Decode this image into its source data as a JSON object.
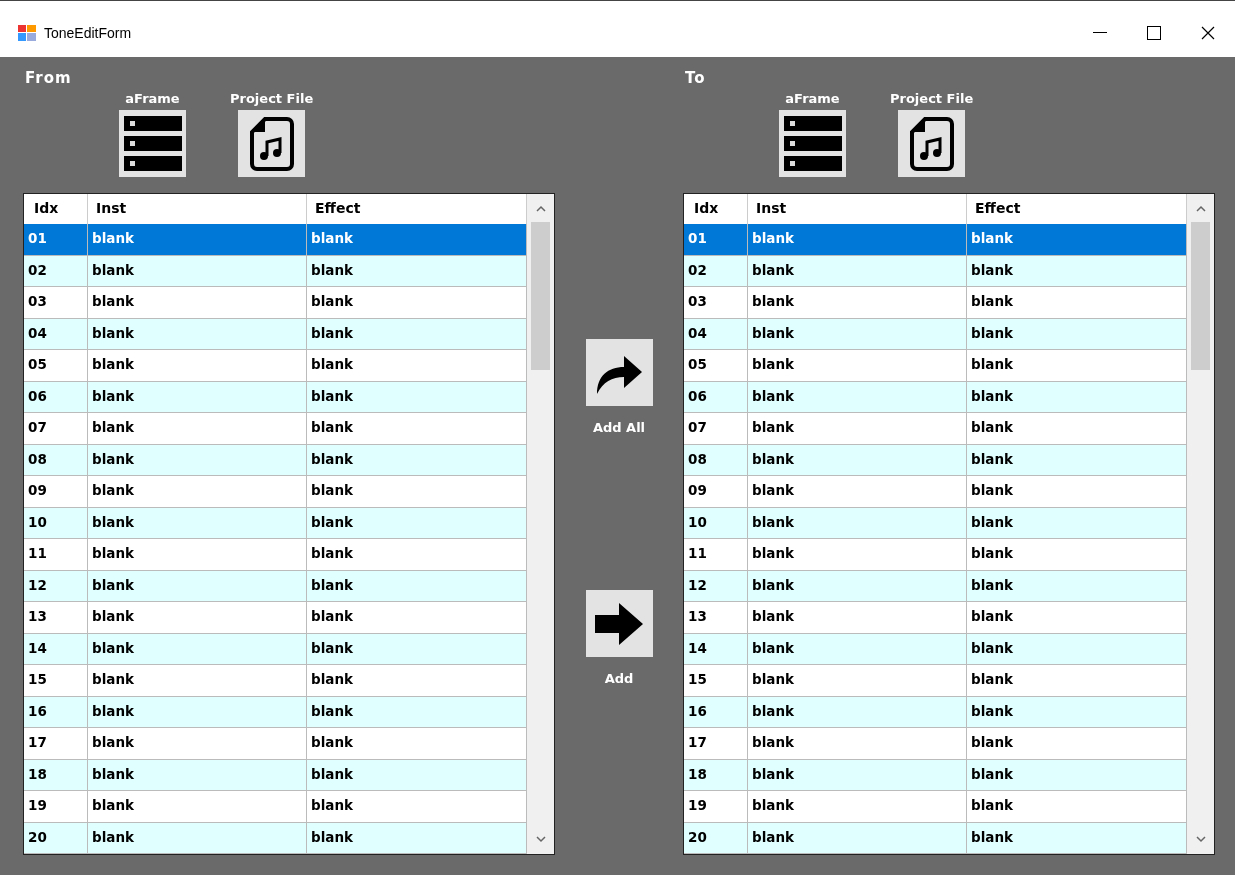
{
  "window": {
    "title": "ToneEditForm"
  },
  "panels": [
    {
      "title": "From",
      "sources": [
        {
          "label": "aFrame",
          "kind": "frame"
        },
        {
          "label": "Project File",
          "kind": "file"
        }
      ],
      "columns": [
        "Idx",
        "Inst",
        "Effect"
      ],
      "rows": [
        {
          "cells": [
            "01",
            "blank",
            "blank"
          ],
          "selected": true
        },
        {
          "cells": [
            "02",
            "blank",
            "blank"
          ],
          "selected": false
        },
        {
          "cells": [
            "03",
            "blank",
            "blank"
          ],
          "selected": false
        },
        {
          "cells": [
            "04",
            "blank",
            "blank"
          ],
          "selected": false
        },
        {
          "cells": [
            "05",
            "blank",
            "blank"
          ],
          "selected": false
        },
        {
          "cells": [
            "06",
            "blank",
            "blank"
          ],
          "selected": false
        },
        {
          "cells": [
            "07",
            "blank",
            "blank"
          ],
          "selected": false
        },
        {
          "cells": [
            "08",
            "blank",
            "blank"
          ],
          "selected": false
        },
        {
          "cells": [
            "09",
            "blank",
            "blank"
          ],
          "selected": false
        },
        {
          "cells": [
            "10",
            "blank",
            "blank"
          ],
          "selected": false
        },
        {
          "cells": [
            "11",
            "blank",
            "blank"
          ],
          "selected": false
        },
        {
          "cells": [
            "12",
            "blank",
            "blank"
          ],
          "selected": false
        },
        {
          "cells": [
            "13",
            "blank",
            "blank"
          ],
          "selected": false
        },
        {
          "cells": [
            "14",
            "blank",
            "blank"
          ],
          "selected": false
        },
        {
          "cells": [
            "15",
            "blank",
            "blank"
          ],
          "selected": false
        },
        {
          "cells": [
            "16",
            "blank",
            "blank"
          ],
          "selected": false
        },
        {
          "cells": [
            "17",
            "blank",
            "blank"
          ],
          "selected": false
        },
        {
          "cells": [
            "18",
            "blank",
            "blank"
          ],
          "selected": false
        },
        {
          "cells": [
            "19",
            "blank",
            "blank"
          ],
          "selected": false
        },
        {
          "cells": [
            "20",
            "blank",
            "blank"
          ],
          "selected": false
        }
      ]
    },
    {
      "title": "To",
      "sources": [
        {
          "label": "aFrame",
          "kind": "frame"
        },
        {
          "label": "Project File",
          "kind": "file"
        }
      ],
      "columns": [
        "Idx",
        "Inst",
        "Effect"
      ],
      "rows": [
        {
          "cells": [
            "01",
            "blank",
            "blank"
          ],
          "selected": true
        },
        {
          "cells": [
            "02",
            "blank",
            "blank"
          ],
          "selected": false
        },
        {
          "cells": [
            "03",
            "blank",
            "blank"
          ],
          "selected": false
        },
        {
          "cells": [
            "04",
            "blank",
            "blank"
          ],
          "selected": false
        },
        {
          "cells": [
            "05",
            "blank",
            "blank"
          ],
          "selected": false
        },
        {
          "cells": [
            "06",
            "blank",
            "blank"
          ],
          "selected": false
        },
        {
          "cells": [
            "07",
            "blank",
            "blank"
          ],
          "selected": false
        },
        {
          "cells": [
            "08",
            "blank",
            "blank"
          ],
          "selected": false
        },
        {
          "cells": [
            "09",
            "blank",
            "blank"
          ],
          "selected": false
        },
        {
          "cells": [
            "10",
            "blank",
            "blank"
          ],
          "selected": false
        },
        {
          "cells": [
            "11",
            "blank",
            "blank"
          ],
          "selected": false
        },
        {
          "cells": [
            "12",
            "blank",
            "blank"
          ],
          "selected": false
        },
        {
          "cells": [
            "13",
            "blank",
            "blank"
          ],
          "selected": false
        },
        {
          "cells": [
            "14",
            "blank",
            "blank"
          ],
          "selected": false
        },
        {
          "cells": [
            "15",
            "blank",
            "blank"
          ],
          "selected": false
        },
        {
          "cells": [
            "16",
            "blank",
            "blank"
          ],
          "selected": false
        },
        {
          "cells": [
            "17",
            "blank",
            "blank"
          ],
          "selected": false
        },
        {
          "cells": [
            "18",
            "blank",
            "blank"
          ],
          "selected": false
        },
        {
          "cells": [
            "19",
            "blank",
            "blank"
          ],
          "selected": false
        },
        {
          "cells": [
            "20",
            "blank",
            "blank"
          ],
          "selected": false
        }
      ]
    }
  ],
  "actions": [
    {
      "label": "Add All",
      "kind": "all"
    },
    {
      "label": "Add",
      "kind": "one"
    }
  ]
}
